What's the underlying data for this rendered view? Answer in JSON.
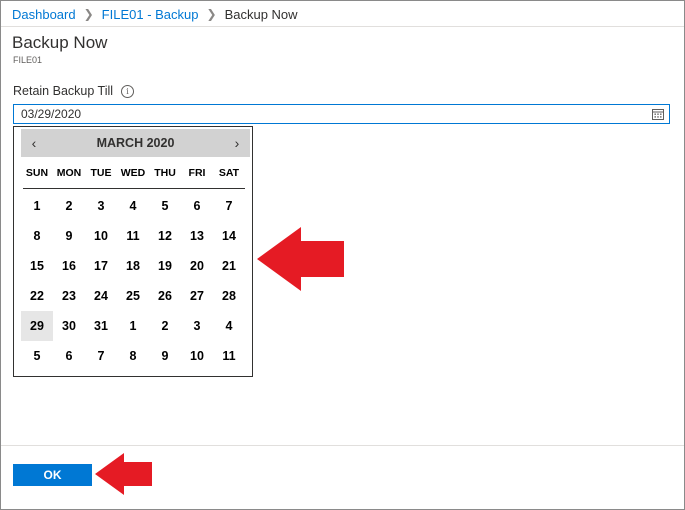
{
  "breadcrumb": {
    "items": [
      "Dashboard",
      "FILE01 - Backup"
    ],
    "current": "Backup Now"
  },
  "page": {
    "title": "Backup Now",
    "subtitle": "FILE01"
  },
  "field": {
    "label": "Retain Backup Till",
    "info_icon": "i",
    "value": "03/29/2020"
  },
  "calendar": {
    "month": "MARCH 2020",
    "prev_icon": "‹",
    "next_icon": "›",
    "weekdays": [
      "SUN",
      "MON",
      "TUE",
      "WED",
      "THU",
      "FRI",
      "SAT"
    ],
    "weeks": [
      [
        "1",
        "2",
        "3",
        "4",
        "5",
        "6",
        "7"
      ],
      [
        "8",
        "9",
        "10",
        "11",
        "12",
        "13",
        "14"
      ],
      [
        "15",
        "16",
        "17",
        "18",
        "19",
        "20",
        "21"
      ],
      [
        "22",
        "23",
        "24",
        "25",
        "26",
        "27",
        "28"
      ],
      [
        "29",
        "30",
        "31",
        "1",
        "2",
        "3",
        "4"
      ],
      [
        "5",
        "6",
        "7",
        "8",
        "9",
        "10",
        "11"
      ]
    ],
    "selected_day": "29"
  },
  "footer": {
    "ok_label": "OK"
  },
  "colors": {
    "accent": "#0078d4",
    "annotation_arrow": "#e51b24"
  }
}
